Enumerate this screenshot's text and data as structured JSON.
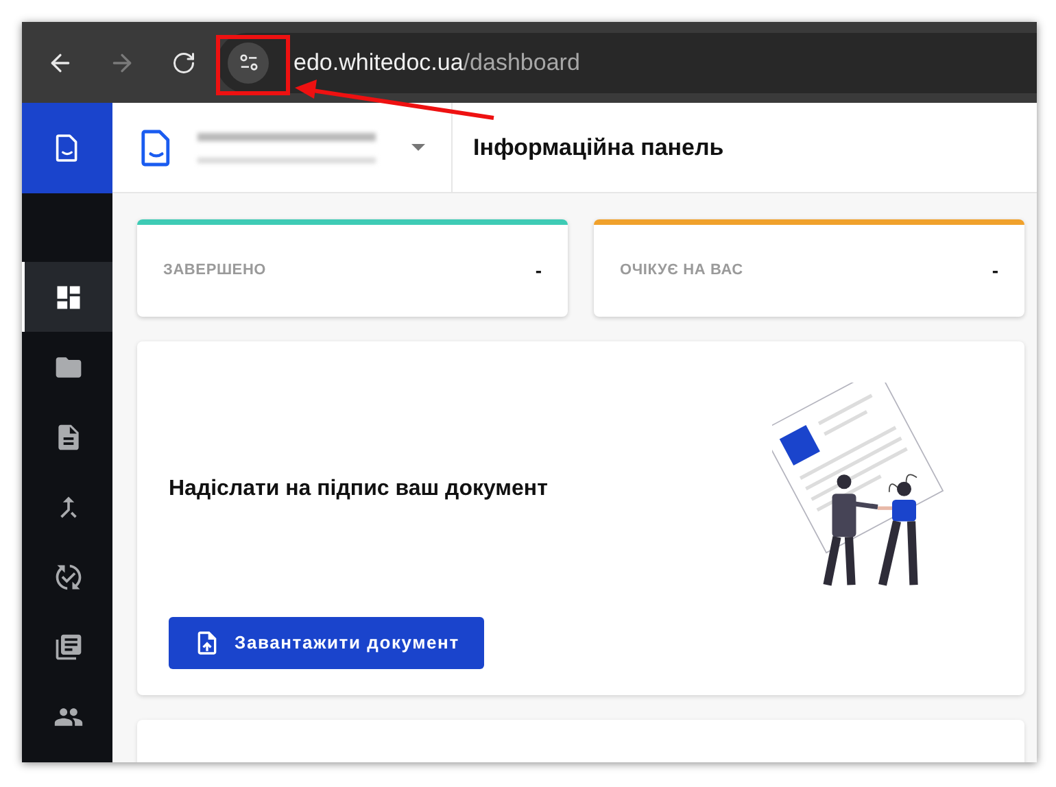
{
  "browser": {
    "url_host": "edo.whitedoc.ua",
    "url_path": "/dashboard",
    "back_disabled": false,
    "forward_disabled": true
  },
  "sidebar": {
    "items": [
      {
        "kind": "dashboard",
        "selected": true
      },
      {
        "kind": "folder",
        "selected": false
      },
      {
        "kind": "document",
        "selected": false
      },
      {
        "kind": "merge",
        "selected": false
      },
      {
        "kind": "sync",
        "selected": false
      },
      {
        "kind": "library",
        "selected": false
      },
      {
        "kind": "people",
        "selected": false
      }
    ]
  },
  "header": {
    "title": "Інформаційна панель"
  },
  "stats": [
    {
      "label": "ЗАВЕРШЕНО",
      "value": "-",
      "color": "#3ecbb5"
    },
    {
      "label": "ОЧІКУЄ НА ВАС",
      "value": "-",
      "color": "#f0a12c"
    }
  ],
  "promo": {
    "title": "Надіслати на підпис ваш документ",
    "button": "Завантажити документ"
  }
}
